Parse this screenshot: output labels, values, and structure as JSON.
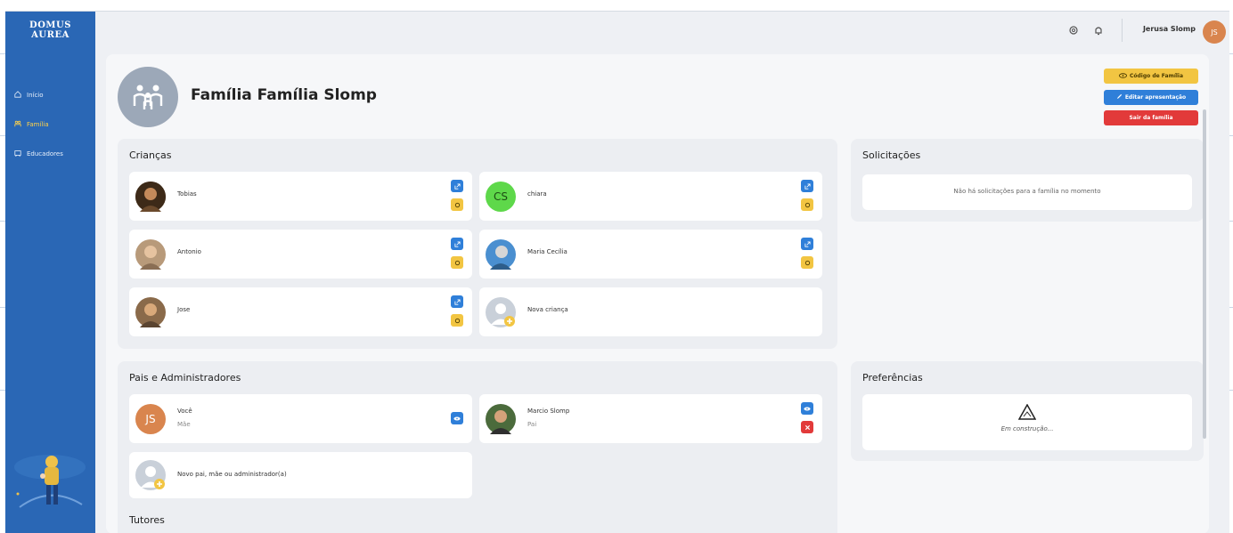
{
  "brand": {
    "line1": "DOMUS",
    "line2": "AUREA"
  },
  "sidebar": {
    "items": [
      {
        "label": "Início",
        "icon": "home-icon"
      },
      {
        "label": "Família",
        "icon": "family-icon",
        "active": true
      },
      {
        "label": "Educadores",
        "icon": "educators-icon"
      }
    ]
  },
  "topbar": {
    "user_name": "Jerusa Slomp",
    "user_initials": "JS"
  },
  "family": {
    "title": "Família Família Slomp"
  },
  "actions": {
    "code": "Código de Família",
    "edit": "Editar apresentação",
    "leave": "Sair da família"
  },
  "children": {
    "title": "Crianças",
    "items": [
      {
        "name": "Tobias"
      },
      {
        "name": "chiara",
        "initials": "CS"
      },
      {
        "name": "Antonio"
      },
      {
        "name": "Maria Cecília"
      },
      {
        "name": "Jose"
      }
    ],
    "new_label": "Nova criança"
  },
  "requests": {
    "title": "Solicitações",
    "empty": "Não há solicitações para a família no momento"
  },
  "parents": {
    "title": "Pais e Administradores",
    "items": [
      {
        "name": "Você",
        "role": "Mãe",
        "initials": "JS"
      },
      {
        "name": "Marcio Slomp",
        "role": "Pai"
      }
    ],
    "new_label": "Novo pai, mãe ou administrador(a)"
  },
  "preferences": {
    "title": "Preferências",
    "empty": "Em construção..."
  },
  "tutors": {
    "title": "Tutores"
  },
  "colors": {
    "sidebar": "#2a67b5",
    "accent_yellow": "#f2c542",
    "accent_blue": "#2f7fd9",
    "danger": "#e23a3a"
  }
}
